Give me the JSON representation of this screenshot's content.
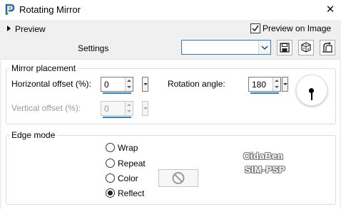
{
  "window": {
    "title": "Rotating Mirror",
    "app_icon": "paintshop-pro-icon",
    "close_glyph": "✕"
  },
  "preview": {
    "toggle_label": "Preview",
    "preview_on_image_label": "Preview on Image",
    "preview_on_image_checked": true
  },
  "settings": {
    "label": "Settings",
    "preset_value": "",
    "buttons": [
      "save-preset-icon",
      "randomize-dice-icon",
      "reset-defaults-icon"
    ]
  },
  "mirror_placement": {
    "group_title": "Mirror placement",
    "horizontal_offset_label": "Horizontal offset (%):",
    "horizontal_offset_value": "0",
    "vertical_offset_label": "Vertical offset (%):",
    "vertical_offset_value": "0",
    "vertical_offset_enabled": false,
    "rotation_angle_label": "Rotation angle:",
    "rotation_angle_value": "180"
  },
  "edge_mode": {
    "group_title": "Edge mode",
    "options": [
      "Wrap",
      "Repeat",
      "Color",
      "Reflect"
    ],
    "selected": "Reflect",
    "color_swatch_icon": "disabled-circle-icon"
  },
  "watermark": {
    "line1": "CidaBen",
    "line2": "SIM-PSP"
  },
  "colors": {
    "accent": "#2f7fc8",
    "panel_bg": "#ffffff",
    "dialog_bg": "#f0f0f0"
  }
}
